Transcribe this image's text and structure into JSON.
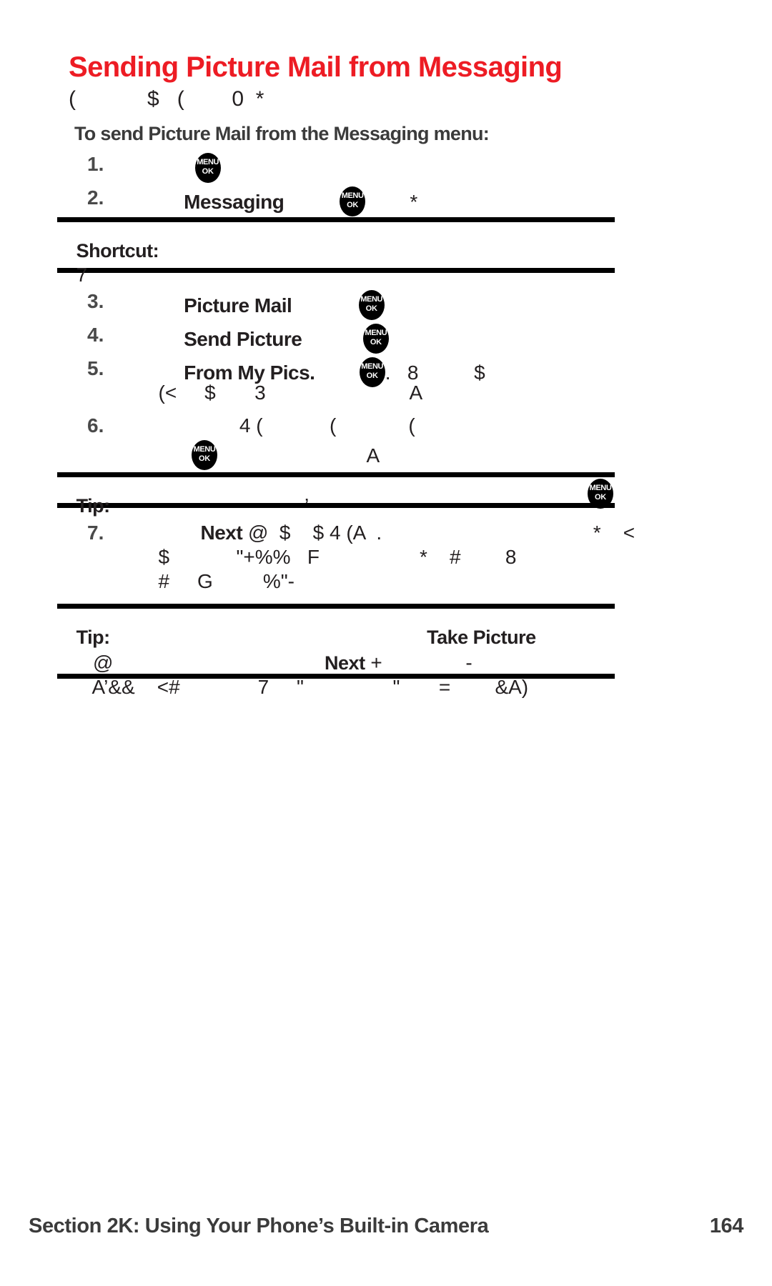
{
  "document": {
    "title": "Sending Picture Mail from Messaging",
    "title_color": "#ed1c24",
    "intro_line": "(            $   (        0  *",
    "lead_in": "To send Picture Mail from the Messaging menu:"
  },
  "steps": [
    {
      "number": "1.",
      "pre": "      ",
      "bold": "",
      "post": "",
      "icon": "menu-ok-key",
      "trailing": "",
      "continuation": ""
    },
    {
      "number": "2.",
      "pre": "    ",
      "bold": "Messaging",
      "post": "          ",
      "icon": "menu-ok-key",
      "trailing": "        *",
      "continuation": ""
    },
    {
      "number": "3.",
      "pre": "    ",
      "bold": "Picture Mail",
      "post": "            ",
      "icon": "menu-ok-key",
      "trailing": "",
      "continuation": ""
    },
    {
      "number": "4.",
      "pre": "    ",
      "bold": "Send Picture",
      "post": "           ",
      "icon": "menu-ok-key",
      "trailing": "",
      "continuation": ""
    },
    {
      "number": "5.",
      "pre": "    ",
      "bold": "From My Pics.",
      "post": "        ",
      "icon": "menu-ok-key",
      "trailing": ".   8          $",
      "continuation": "  (<     $       3                          A"
    },
    {
      "number": "6.",
      "pre": "              4 (            (             (",
      "bold": "",
      "post": "",
      "icon": "",
      "trailing": "",
      "continuation": ""
    }
  ],
  "step6_continuation": {
    "icon": "menu-ok-key",
    "text": "                           A"
  },
  "step7": {
    "number": "7.",
    "pre": "       ",
    "bold": "Next",
    "post": " @  $    $ 4 (A  .                                      *    <",
    "line2": "  $            \"+%%   F                  *    #        8",
    "line3": "  #     G         %\"-"
  },
  "shortcut_callout": {
    "label": "Shortcut:",
    "line1": "",
    "line2": "7"
  },
  "tip_callout_1": {
    "label": "Tip:",
    "line1": "                                   ’",
    "icon": "menu-ok-key"
  },
  "tip_callout_2": {
    "label": "Tip:",
    "line1_spacer": "                                                         ",
    "line1_bold": "Take Picture",
    "line2_pre": "   @                                      ",
    "line2_bold": "Next",
    "line2_post": " +               -",
    "line3": "   A’&&    <#              7     \"                \"       =        &A)"
  },
  "icons": {
    "menu_ok": {
      "name": "menu-ok-key",
      "top_label": "MENU",
      "bottom_label": "OK"
    }
  },
  "footer": {
    "section_text": "Section 2K: Using Your Phone’s Built-in Camera",
    "page_number": "164"
  }
}
